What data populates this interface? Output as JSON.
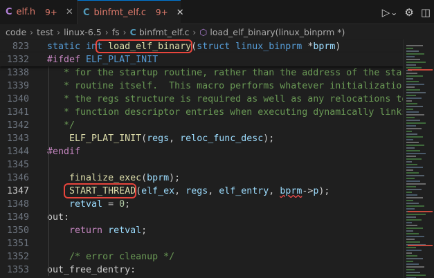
{
  "tabs": [
    {
      "icon": "C",
      "name": "elf.h",
      "badge": "9+",
      "close": "✕"
    },
    {
      "icon": "C",
      "name": "binfmt_elf.c",
      "badge": "9+",
      "close": "✕"
    }
  ],
  "toolbar_icons": {
    "run": "▷",
    "run_menu": "⌄",
    "settings": "⚙",
    "split": "◫"
  },
  "breadcrumb": {
    "parts": [
      "code",
      "test",
      "linux-6.5",
      "fs"
    ],
    "file_icon": "C",
    "file": "binfmt_elf.c",
    "symbol_icon": "⬡",
    "symbol": "load_elf_binary(linux_binprm *)"
  },
  "lines": [
    {
      "n": "823",
      "sticky": true,
      "code": [
        [
          "kw",
          "static "
        ],
        [
          "kw",
          "int "
        ],
        [
          "fnc",
          "load_elf_binary"
        ],
        [
          "",
          "("
        ],
        [
          "kw",
          "struct "
        ],
        [
          "kw",
          "linux_binprm "
        ],
        [
          "",
          "*"
        ],
        [
          "var",
          "bprm"
        ],
        [
          "",
          ")"
        ]
      ]
    },
    {
      "n": "1332",
      "sticky": true,
      "code": [
        [
          "ctl",
          "#ifdef "
        ],
        [
          "mac",
          "ELF_PLAT_INIT"
        ]
      ]
    },
    {
      "n": "1338",
      "code": [
        [
          "cmt",
          "   * for the startup routine, rather than the address of the star"
        ]
      ]
    },
    {
      "n": "1339",
      "code": [
        [
          "cmt",
          "   * routine itself.  This macro performs whatever initializatio"
        ]
      ]
    },
    {
      "n": "1340",
      "code": [
        [
          "cmt",
          "   * the regs structure is required as well as any relocations to"
        ]
      ]
    },
    {
      "n": "1341",
      "code": [
        [
          "cmt",
          "   * function descriptor entries when executing dynamically links"
        ]
      ]
    },
    {
      "n": "1342",
      "code": [
        [
          "cmt",
          "   */"
        ]
      ]
    },
    {
      "n": "1343",
      "code": [
        [
          "",
          "    "
        ],
        [
          "fnc",
          "ELF_PLAT_INIT"
        ],
        [
          "",
          "("
        ],
        [
          "var",
          "regs"
        ],
        [
          "",
          ", "
        ],
        [
          "var",
          "reloc_func_desc"
        ],
        [
          "",
          ");"
        ]
      ]
    },
    {
      "n": "1344",
      "code": [
        [
          "ctl",
          "#endif"
        ]
      ]
    },
    {
      "n": "1345",
      "code": [
        [
          "",
          ""
        ]
      ]
    },
    {
      "n": "1346",
      "code": [
        [
          "",
          "    "
        ],
        [
          "fnc",
          "finalize_exec"
        ],
        [
          "",
          "("
        ],
        [
          "var",
          "bprm"
        ],
        [
          "",
          ");"
        ]
      ]
    },
    {
      "n": "1347",
      "active": true,
      "code": [
        [
          "",
          "    "
        ],
        [
          "fnc",
          "START_THREAD"
        ],
        [
          "",
          "("
        ],
        [
          "var",
          "elf_ex"
        ],
        [
          "",
          ", "
        ],
        [
          "var",
          "regs"
        ],
        [
          "",
          ", "
        ],
        [
          "var",
          "elf_entry"
        ],
        [
          "",
          ", "
        ],
        [
          "var",
          "bprm"
        ],
        [
          "",
          "->"
        ],
        [
          "var",
          "p"
        ],
        [
          "",
          ");"
        ]
      ]
    },
    {
      "n": "1348",
      "code": [
        [
          "",
          "    "
        ],
        [
          "var",
          "retval"
        ],
        [
          "",
          " = "
        ],
        [
          "num",
          "0"
        ],
        [
          "",
          ";"
        ]
      ]
    },
    {
      "n": "1349",
      "code": [
        [
          "",
          "out:"
        ]
      ]
    },
    {
      "n": "1350",
      "code": [
        [
          "",
          "    "
        ],
        [
          "ctl",
          "return "
        ],
        [
          "var",
          "retval"
        ],
        [
          "",
          ";"
        ]
      ]
    },
    {
      "n": "1351",
      "code": [
        [
          "",
          ""
        ]
      ]
    },
    {
      "n": "1352",
      "code": [
        [
          "",
          "    "
        ],
        [
          "cmt",
          "/* error cleanup */"
        ]
      ]
    },
    {
      "n": "1353",
      "code": [
        [
          "",
          "out_free_dentry:"
        ]
      ]
    }
  ]
}
